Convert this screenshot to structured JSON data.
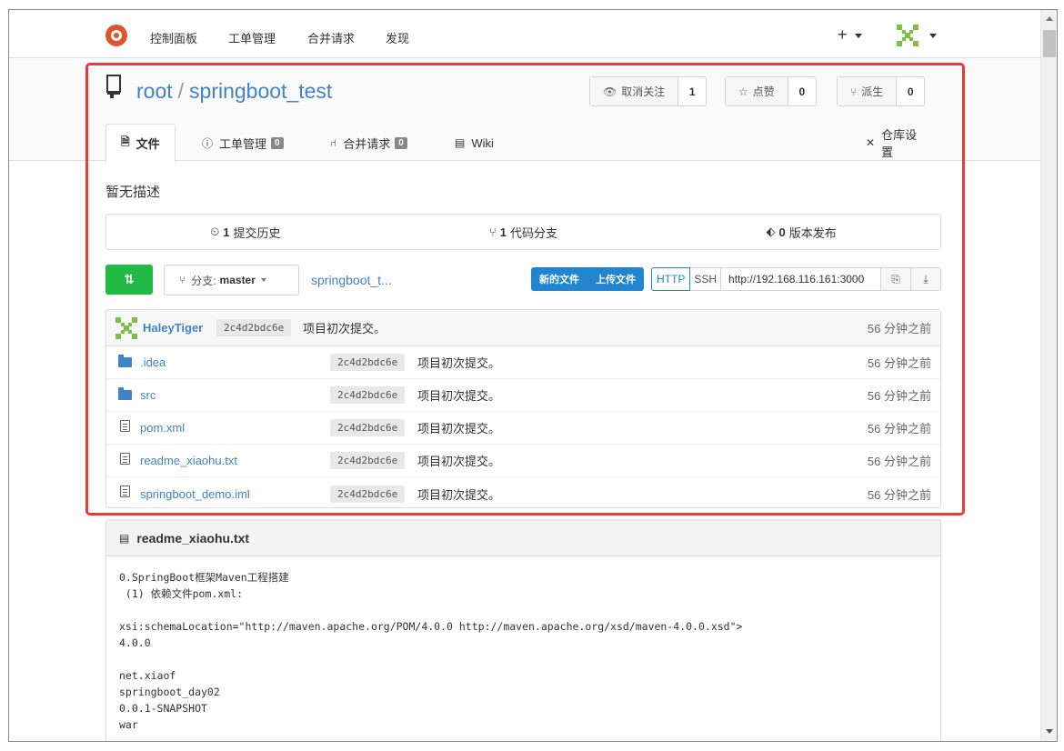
{
  "colors": {
    "link": "#4183c4",
    "primary": "#2185d0",
    "green": "#21ba45",
    "highlight": "#e83a36"
  },
  "nav": {
    "items": [
      "控制面板",
      "工单管理",
      "合并请求",
      "发现"
    ],
    "plus": "+"
  },
  "repo": {
    "owner": "root",
    "separator": "/",
    "name": "springboot_test",
    "watch": {
      "label": "取消关注",
      "count": "1"
    },
    "star": {
      "label": "点赞",
      "count": "0"
    },
    "fork": {
      "label": "派生",
      "count": "0"
    }
  },
  "tabs": {
    "files": "文件",
    "issues": "工单管理",
    "issues_count": "0",
    "pulls": "合并请求",
    "pulls_count": "0",
    "wiki": "Wiki",
    "settings": "仓库设置"
  },
  "description": "暂无描述",
  "stats": {
    "commits_count": "1",
    "commits_label": "提交历史",
    "branches_count": "1",
    "branches_label": "代码分支",
    "releases_count": "0",
    "releases_label": "版本发布"
  },
  "toolbar": {
    "branch_prefix": "分支:",
    "branch": "master",
    "path": "springboot_t...",
    "new_file": "新的文件",
    "upload_file": "上传文件",
    "http": "HTTP",
    "ssh": "SSH",
    "clone_url": "http://192.168.116.161:3000"
  },
  "latest_commit": {
    "author": "HaleyTiger",
    "sha": "2c4d2bdc6e",
    "message": "项目初次提交。",
    "time": "56 分钟之前"
  },
  "files": [
    {
      "name": ".idea",
      "type": "folder",
      "sha": "2c4d2bdc6e",
      "message": "项目初次提交。",
      "time": "56 分钟之前"
    },
    {
      "name": "src",
      "type": "folder",
      "sha": "2c4d2bdc6e",
      "message": "项目初次提交。",
      "time": "56 分钟之前"
    },
    {
      "name": "pom.xml",
      "type": "file",
      "sha": "2c4d2bdc6e",
      "message": "项目初次提交。",
      "time": "56 分钟之前"
    },
    {
      "name": "readme_xiaohu.txt",
      "type": "file",
      "sha": "2c4d2bdc6e",
      "message": "项目初次提交。",
      "time": "56 分钟之前"
    },
    {
      "name": "springboot_demo.iml",
      "type": "file",
      "sha": "2c4d2bdc6e",
      "message": "项目初次提交。",
      "time": "56 分钟之前"
    }
  ],
  "readme": {
    "title": "readme_xiaohu.txt",
    "content": "0.SpringBoot框架Maven工程搭建\n (1) 依赖文件pom.xml:\n\nxsi:schemaLocation=\"http://maven.apache.org/POM/4.0.0 http://maven.apache.org/xsd/maven-4.0.0.xsd\">\n4.0.0\n\nnet.xiaof\nspringboot_day02\n0.0.1-SNAPSHOT\nwar"
  }
}
